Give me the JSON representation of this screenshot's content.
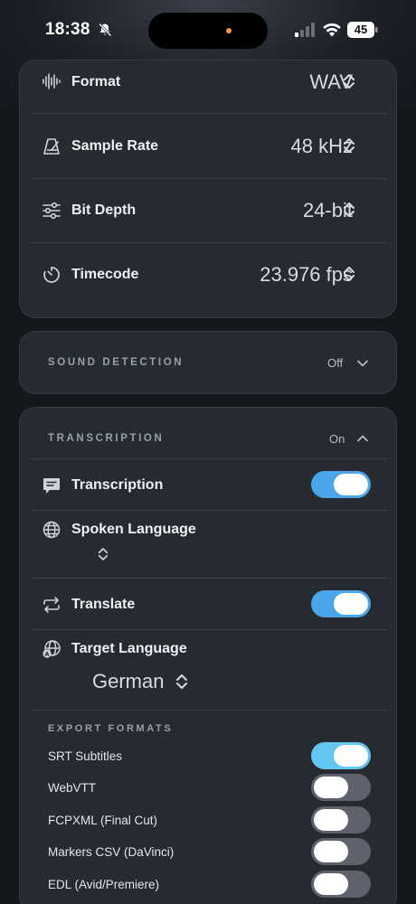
{
  "status_bar": {
    "time": "18:38",
    "battery": "45"
  },
  "recording": {
    "rows": [
      {
        "label": "Format",
        "value": "WAV",
        "icon": "waveform-icon"
      },
      {
        "label": "Sample Rate",
        "value": "48 kHz",
        "icon": "metronome-icon"
      },
      {
        "label": "Bit Depth",
        "value": "24-bit",
        "icon": "sliders-icon"
      },
      {
        "label": "Timecode",
        "value": "23.976 fps",
        "icon": "timer-icon"
      }
    ]
  },
  "sound_detection": {
    "title": "SOUND DETECTION",
    "state": "Off"
  },
  "transcription": {
    "title": "TRANSCRIPTION",
    "state": "On",
    "transcription_toggle": {
      "label": "Transcription",
      "on": true
    },
    "spoken_language": {
      "label": "Spoken Language",
      "value": ""
    },
    "translate_toggle": {
      "label": "Translate",
      "on": true
    },
    "target_language": {
      "label": "Target Language",
      "value": "German"
    },
    "export_title": "EXPORT FORMATS",
    "export_formats": [
      {
        "label": "SRT Subtitles",
        "on": true
      },
      {
        "label": "WebVTT",
        "on": false
      },
      {
        "label": "FCPXML (Final Cut)",
        "on": false
      },
      {
        "label": "Markers CSV (DaVinci)",
        "on": false
      },
      {
        "label": "EDL (Avid/Premiere)",
        "on": false
      }
    ]
  },
  "colors": {
    "accent": "#4aa6e8",
    "card": "#262a31",
    "background": "#14171c"
  }
}
